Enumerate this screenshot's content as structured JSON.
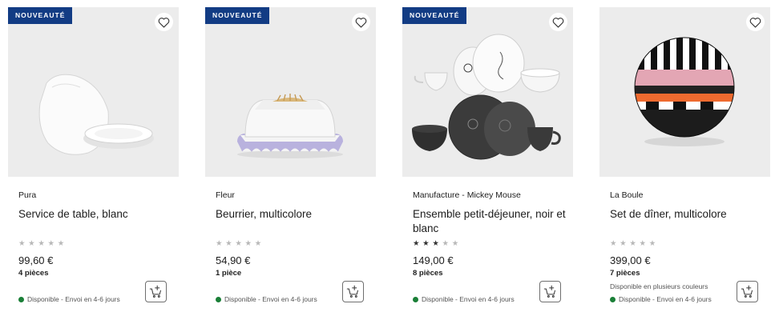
{
  "products": [
    {
      "badge": "NOUVEAUTÉ",
      "brand": "Pura",
      "title": "Service de table, blanc",
      "rating": 0,
      "stars": [
        "★",
        "★",
        "★",
        "★",
        "★"
      ],
      "price": "99,60 €",
      "pieces": "4 pièces",
      "note": "",
      "availability": "Disponible - Envoi en 4-6 jours"
    },
    {
      "badge": "NOUVEAUTÉ",
      "brand": "Fleur",
      "title": "Beurrier, multicolore",
      "rating": 0,
      "stars": [
        "★",
        "★",
        "★",
        "★",
        "★"
      ],
      "price": "54,90 €",
      "pieces": "1 pièce",
      "note": "",
      "availability": "Disponible - Envoi en 4-6 jours"
    },
    {
      "badge": "NOUVEAUTÉ",
      "brand": "Manufacture - Mickey Mouse",
      "title": "Ensemble petit-déjeuner, noir et blanc",
      "rating": 3,
      "stars": [
        "★",
        "★",
        "★",
        "★",
        "★"
      ],
      "price": "149,00 €",
      "pieces": "8 pièces",
      "note": "",
      "availability": "Disponible - Envoi en 4-6 jours"
    },
    {
      "badge": "",
      "brand": "La Boule",
      "title": "Set de dîner, multicolore",
      "rating": 0,
      "stars": [
        "★",
        "★",
        "★",
        "★",
        "★"
      ],
      "price": "399,00 €",
      "pieces": "7 pièces",
      "note": "Disponible en plusieurs couleurs",
      "availability": "Disponible - Envoi en 4-6 jours"
    }
  ],
  "icons": {
    "favorite": "heart-outline-icon",
    "cart": "add-to-cart-icon",
    "availability": "green-dot-icon"
  },
  "colors": {
    "badge_bg": "#123c84",
    "availability_dot": "#1a7f37",
    "image_bg": "#ececec",
    "star_filled": "#333333",
    "star_empty": "#b8b8b8"
  }
}
